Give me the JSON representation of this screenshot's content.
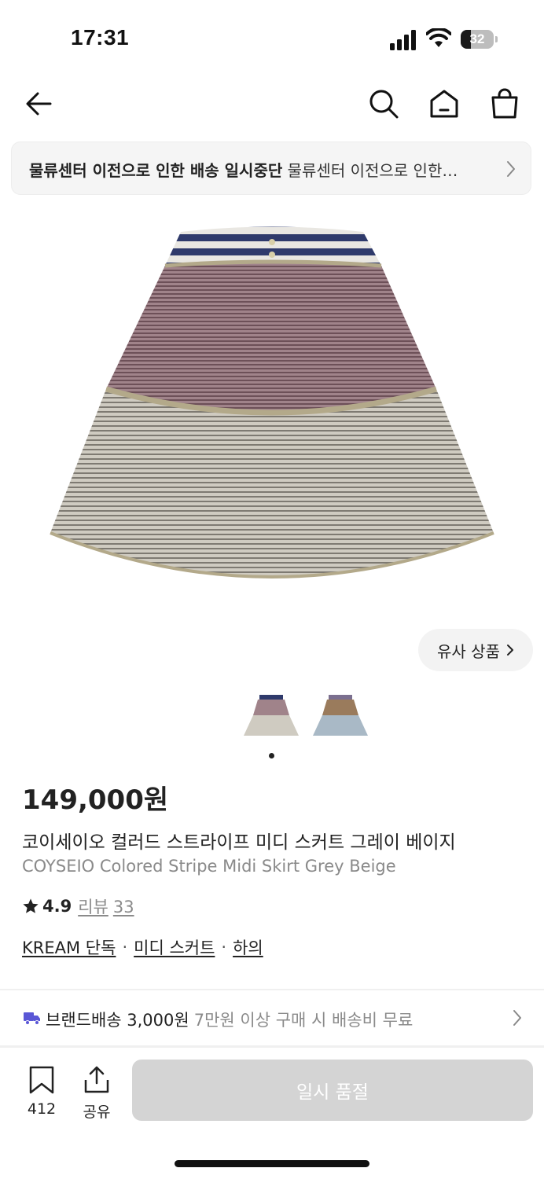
{
  "status_bar": {
    "time": "17:31",
    "battery": "32",
    "battery_level": 0.32
  },
  "header": {
    "icons": [
      "back-arrow-icon",
      "search-icon",
      "home-icon",
      "shopping-bag-icon"
    ]
  },
  "notice": {
    "title": "물류센터 이전으로 인한 배송 일시중단",
    "text": "물류센터 이전으로 인한…"
  },
  "gallery": {
    "similar_label": "유사 상품"
  },
  "product": {
    "price": "149,000원",
    "name_ko": "코이세이오 컬러드 스트라이프 미디 스커트 그레이 베이지",
    "name_en": "COYSEIO Colored Stripe Midi Skirt Grey Beige",
    "rating": "4.9",
    "review_label": "리뷰",
    "review_count": "33",
    "tags": [
      "KREAM 단독",
      "미디 스커트",
      "하의"
    ],
    "tag_separator": "·"
  },
  "shipping": {
    "label": "브랜드배송 3,000원",
    "note": "7만원 이상 구매 시 배송비 무료"
  },
  "bottom_bar": {
    "wish_count": "412",
    "share_label": "공유",
    "action_label": "일시 품절"
  },
  "colors": {
    "shipping_icon": "#5a57d6",
    "soldout_button": "#d4d4d4",
    "muted_text": "#8a8a8a"
  }
}
